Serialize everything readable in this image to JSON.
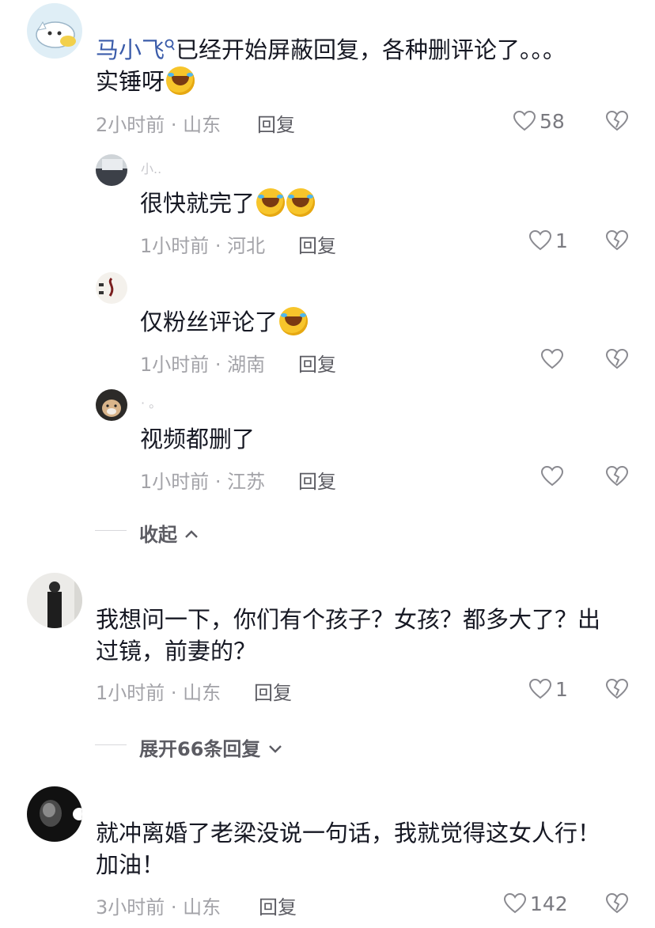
{
  "comments": [
    {
      "mention": "马小飞",
      "text_line1": "已经开始屏蔽回复，各种删评论了。。。",
      "text_line2": "实锤呀",
      "meta": "2小时前 · 山东",
      "reply": "回复",
      "likes": "58",
      "replies": [
        {
          "username": "小..",
          "text": "很快就完了",
          "meta": "1小时前 · 河北",
          "reply": "回复",
          "likes": "1"
        },
        {
          "username": "",
          "text": "仅粉丝评论了",
          "meta": "1小时前 · 湖南",
          "reply": "回复",
          "likes": ""
        },
        {
          "username": "·  。",
          "text": "视频都删了",
          "meta": "1小时前 · 江苏",
          "reply": "回复",
          "likes": ""
        }
      ],
      "collapse_label": "收起"
    },
    {
      "text_line1": "我想问一下，你们有个孩子？女孩？都多大了？出",
      "text_line2": "过镜，前妻的？",
      "meta": "1小时前 · 山东",
      "reply": "回复",
      "likes": "1",
      "expand_label": "展开66条回复"
    },
    {
      "text_line1": "就冲离婚了老梁没说一句话，我就觉得这女人行！",
      "text_line2": "加油！",
      "meta": "3小时前 · 山东",
      "reply": "回复",
      "likes": "142"
    }
  ],
  "icons": {
    "like": "heart-outline-icon",
    "dislike": "broken-heart-icon",
    "search": "search-icon",
    "chevron_up": "chevron-up-icon",
    "chevron_down": "chevron-down-icon"
  }
}
